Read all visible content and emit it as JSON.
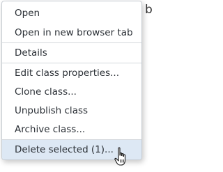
{
  "background": {
    "partial_text": "b"
  },
  "menu": {
    "items": [
      {
        "label": "Open"
      },
      {
        "label": "Open in new browser tab"
      },
      {
        "label": "Details"
      },
      {
        "label": "Edit class properties..."
      },
      {
        "label": "Clone class..."
      },
      {
        "label": "Unpublish class"
      },
      {
        "label": "Archive class..."
      },
      {
        "label": "Delete selected (1)..."
      }
    ],
    "hover_color": "#dde8f4",
    "text_color": "#2b3036"
  },
  "cursor": {
    "icon": "hand-pointer-icon"
  }
}
